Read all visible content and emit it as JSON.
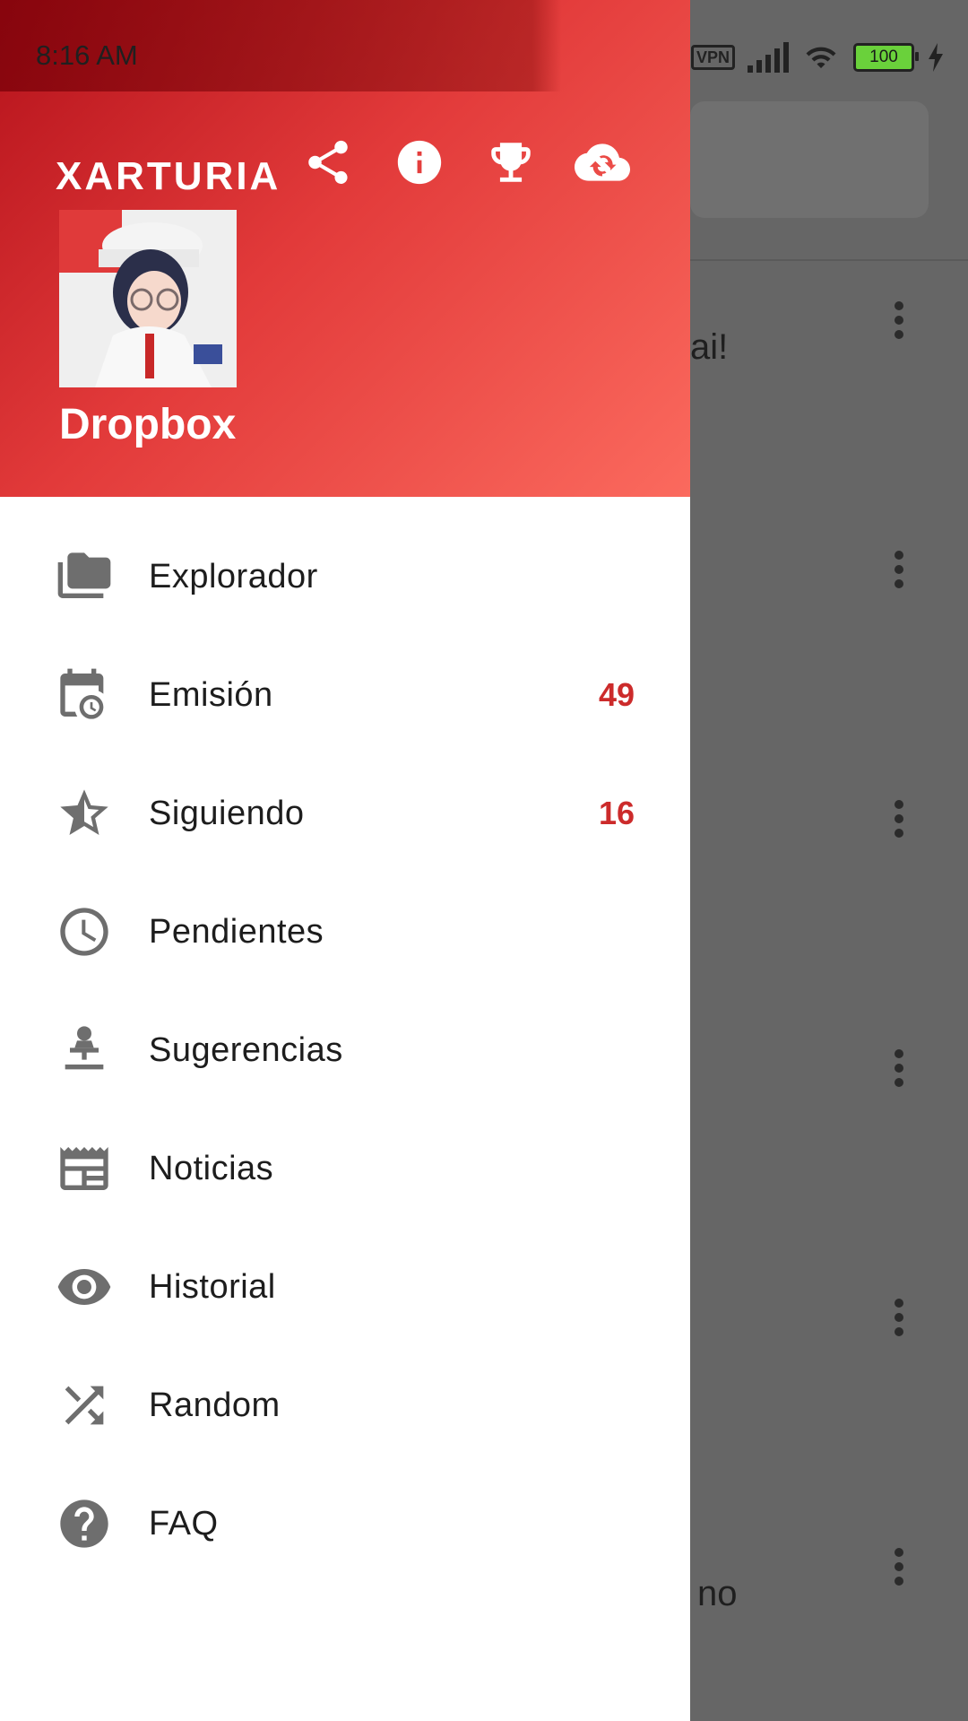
{
  "status_bar": {
    "time": "8:16 AM",
    "vpn_label": "VPN",
    "battery_level": "100",
    "icons": [
      "vpn-icon",
      "signal-icon",
      "wifi-icon",
      "battery-icon",
      "charging-icon"
    ]
  },
  "header": {
    "brand": "XARTURIA",
    "account_name": "Dropbox",
    "actions": [
      {
        "icon": "share-icon"
      },
      {
        "icon": "info-icon"
      },
      {
        "icon": "trophy-icon"
      },
      {
        "icon": "cloud-sync-icon"
      }
    ],
    "colors": {
      "gradient_start": "#b5121b",
      "gradient_end": "#fb6a5e"
    }
  },
  "menu": {
    "badge_color": "#cc2b2b",
    "items": [
      {
        "label": "Explorador",
        "icon": "folders-icon",
        "badge": ""
      },
      {
        "label": "Emisión",
        "icon": "calendar-clock-icon",
        "badge": "49"
      },
      {
        "label": "Siguiendo",
        "icon": "star-half-icon",
        "badge": "16"
      },
      {
        "label": "Pendientes",
        "icon": "clock-icon",
        "badge": ""
      },
      {
        "label": "Sugerencias",
        "icon": "person-pin-icon",
        "badge": ""
      },
      {
        "label": "Noticias",
        "icon": "newspaper-icon",
        "badge": ""
      },
      {
        "label": "Historial",
        "icon": "eye-icon",
        "badge": ""
      },
      {
        "label": "Random",
        "icon": "shuffle-icon",
        "badge": ""
      },
      {
        "label": "FAQ",
        "icon": "help-icon",
        "badge": ""
      }
    ]
  },
  "background": {
    "text_1": "ai!",
    "text_2": "no"
  }
}
